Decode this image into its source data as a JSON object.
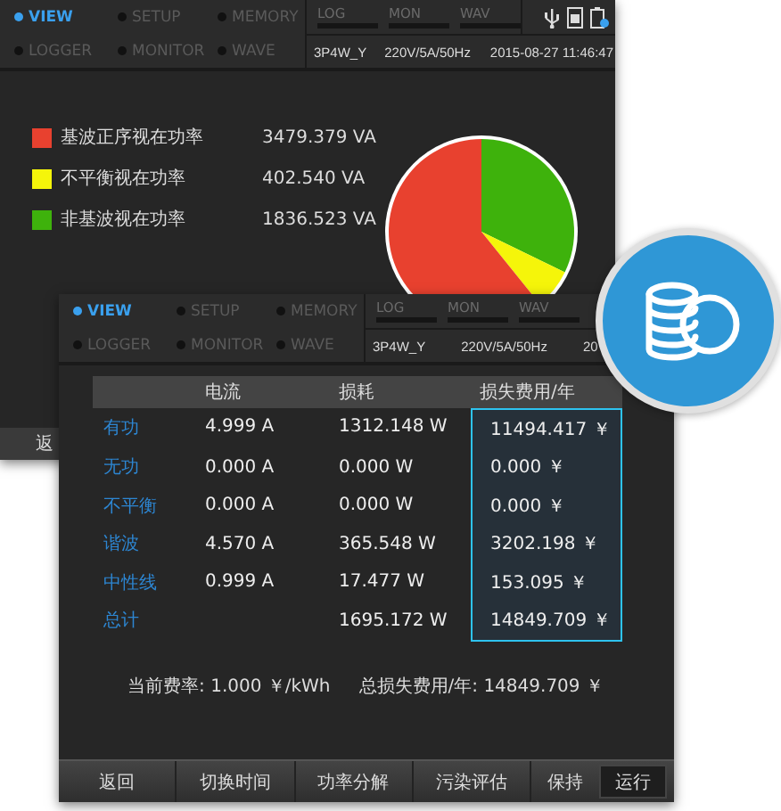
{
  "back_screen": {
    "nav": [
      {
        "label": "VIEW",
        "selected": true
      },
      {
        "label": "SETUP",
        "selected": false
      },
      {
        "label": "MEMORY",
        "selected": false
      },
      {
        "label": "LOGGER",
        "selected": false
      },
      {
        "label": "MONITOR",
        "selected": false
      },
      {
        "label": "WAVE",
        "selected": false
      }
    ],
    "indicators": [
      "LOG",
      "MON",
      "WAV"
    ],
    "status": [
      "3P4W_Y",
      "220V/5A/50Hz",
      "2015-08-27 11:46:47"
    ],
    "legend": [
      {
        "label": "基波正序视在功率",
        "value": "3479.379 VA",
        "color": "#e8412f"
      },
      {
        "label": "不平衡视在功率",
        "value": "402.540 VA",
        "color": "#f5f50a"
      },
      {
        "label": "非基波视在功率",
        "value": "1836.523 VA",
        "color": "#3eb20c"
      }
    ],
    "buttons": [
      "返"
    ]
  },
  "front_screen": {
    "nav": [
      {
        "label": "VIEW",
        "selected": true
      },
      {
        "label": "SETUP",
        "selected": false
      },
      {
        "label": "MEMORY",
        "selected": false
      },
      {
        "label": "LOGGER",
        "selected": false
      },
      {
        "label": "MONITOR",
        "selected": false
      },
      {
        "label": "WAVE",
        "selected": false
      }
    ],
    "indicators": [
      "LOG",
      "MON",
      "WAV"
    ],
    "status": [
      "3P4W_Y",
      "220V/5A/50Hz",
      "20"
    ],
    "table": {
      "columns": [
        {
          "highlighted": false
        },
        {
          "label": "电流",
          "highlighted": false
        },
        {
          "label": "损耗",
          "highlighted": false
        },
        {
          "label": "损失费用/年",
          "highlighted": true
        }
      ],
      "rows": [
        [
          "有功",
          "4.999 A",
          "1312.148 W",
          "11494.417 ￥"
        ],
        [
          "无功",
          "0.000 A",
          "0.000 W",
          "0.000 ￥"
        ],
        [
          "不平衡",
          "0.000 A",
          "0.000 W",
          "0.000 ￥"
        ],
        [
          "谐波",
          "4.570 A",
          "365.548 W",
          "3202.198 ￥"
        ],
        [
          "中性线",
          "0.999 A",
          "17.477 W",
          "153.095 ￥"
        ],
        [
          "总计",
          "",
          "1695.172 W",
          "14849.709 ￥"
        ]
      ]
    },
    "summary": [
      "当前费率: 1.000 ￥/kWh",
      "总损失费用/年: 14849.709 ￥"
    ],
    "buttons": [
      {
        "label": "返回",
        "selected": false
      },
      {
        "label": "切换时间",
        "selected": false
      },
      {
        "label": "功率分解",
        "selected": false
      },
      {
        "label": "污染评估",
        "selected": false
      },
      {
        "label": "保持",
        "selected": false
      },
      {
        "label": "运行",
        "selected": true
      }
    ]
  }
}
